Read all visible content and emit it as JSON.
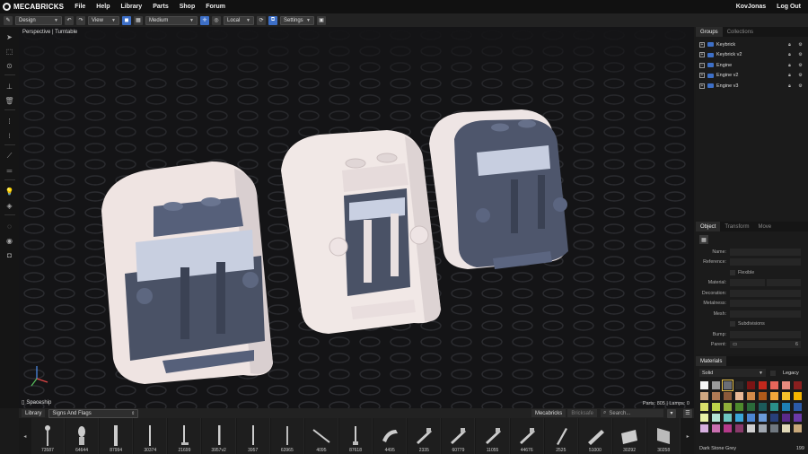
{
  "app": {
    "name": "MECABRICKS"
  },
  "menu": {
    "items": [
      "File",
      "Help",
      "Library",
      "Parts",
      "Shop",
      "Forum"
    ],
    "user": "KovJonas",
    "logout": "Log Out"
  },
  "toolbar": {
    "mode": "Design",
    "view": "View",
    "quality": "Medium",
    "space": "Local",
    "settings": "Settings"
  },
  "viewport": {
    "label": "Perspective | Turntable",
    "status": "Parts: 805 | Lamps: 0",
    "scene_name": "Spaceship"
  },
  "groups": {
    "tabs": [
      "Groups",
      "Collections"
    ],
    "items": [
      {
        "name": "Keybrick",
        "expand": "+"
      },
      {
        "name": "Keybrick v2",
        "expand": "+"
      },
      {
        "name": "Engine",
        "expand": "−"
      },
      {
        "name": "Engine v2",
        "expand": "+"
      },
      {
        "name": "Engine v3",
        "expand": "+"
      }
    ]
  },
  "object": {
    "tabs": [
      "Object",
      "Transform",
      "Move"
    ],
    "fields": {
      "name": "Name:",
      "reference": "Reference:",
      "flexible": "Flexible",
      "material": "Material:",
      "decoration": "Decoration:",
      "metalness": "Metalness:",
      "mesh": "Mesh:",
      "subdivisions": "Subdivisions",
      "bump": "Bump:",
      "parent": "Parent:",
      "parent_value": "6"
    }
  },
  "materials": {
    "tab": "Materials",
    "type": "Solid",
    "legacy": "Legacy",
    "selected_name": "Dark Stone Grey",
    "selected_id": "199",
    "swatches": [
      "#f4f4f4",
      "#9a9a9a",
      "#6b6e76",
      "#2a2a2a",
      "#7a1414",
      "#c4281c",
      "#e7665a",
      "#e88c7f",
      "#8a1f1f",
      "#cfa781",
      "#b07a55",
      "#8b5a3a",
      "#e8b896",
      "#d38b4a",
      "#b05a1a",
      "#f2a73a",
      "#f6c22b",
      "#f4b400",
      "#d9e06b",
      "#bdd34a",
      "#8fae3a",
      "#4e8a2d",
      "#2a6a3a",
      "#1c5a5a",
      "#2a8f8a",
      "#1e7fb5",
      "#2b5aa8",
      "#e9f2a8",
      "#b5e3d6",
      "#6ec6c1",
      "#3aa6d9",
      "#4c86d2",
      "#6b9ad8",
      "#28407a",
      "#5a2a8a",
      "#6b3aa8",
      "#d6b0e0",
      "#c96fb0",
      "#b43a8a",
      "#8a3a6b",
      "#d0d0d0",
      "#a0a7b0",
      "#707880",
      "#e0d8b8",
      "#c8a87a"
    ],
    "selected_index": 2
  },
  "library": {
    "tab": "Library",
    "category": "Signs And Flags",
    "source_tabs": [
      "Mecabricks",
      "Bricksafe"
    ],
    "search_placeholder": "Search..."
  },
  "parts": [
    "73587",
    "64644",
    "87994",
    "30374",
    "21699",
    "3957v2",
    "3957",
    "63965",
    "4095",
    "87618",
    "4495",
    "2335",
    "60779",
    "11055",
    "44676",
    "2525",
    "51000",
    "30292",
    "30258"
  ]
}
